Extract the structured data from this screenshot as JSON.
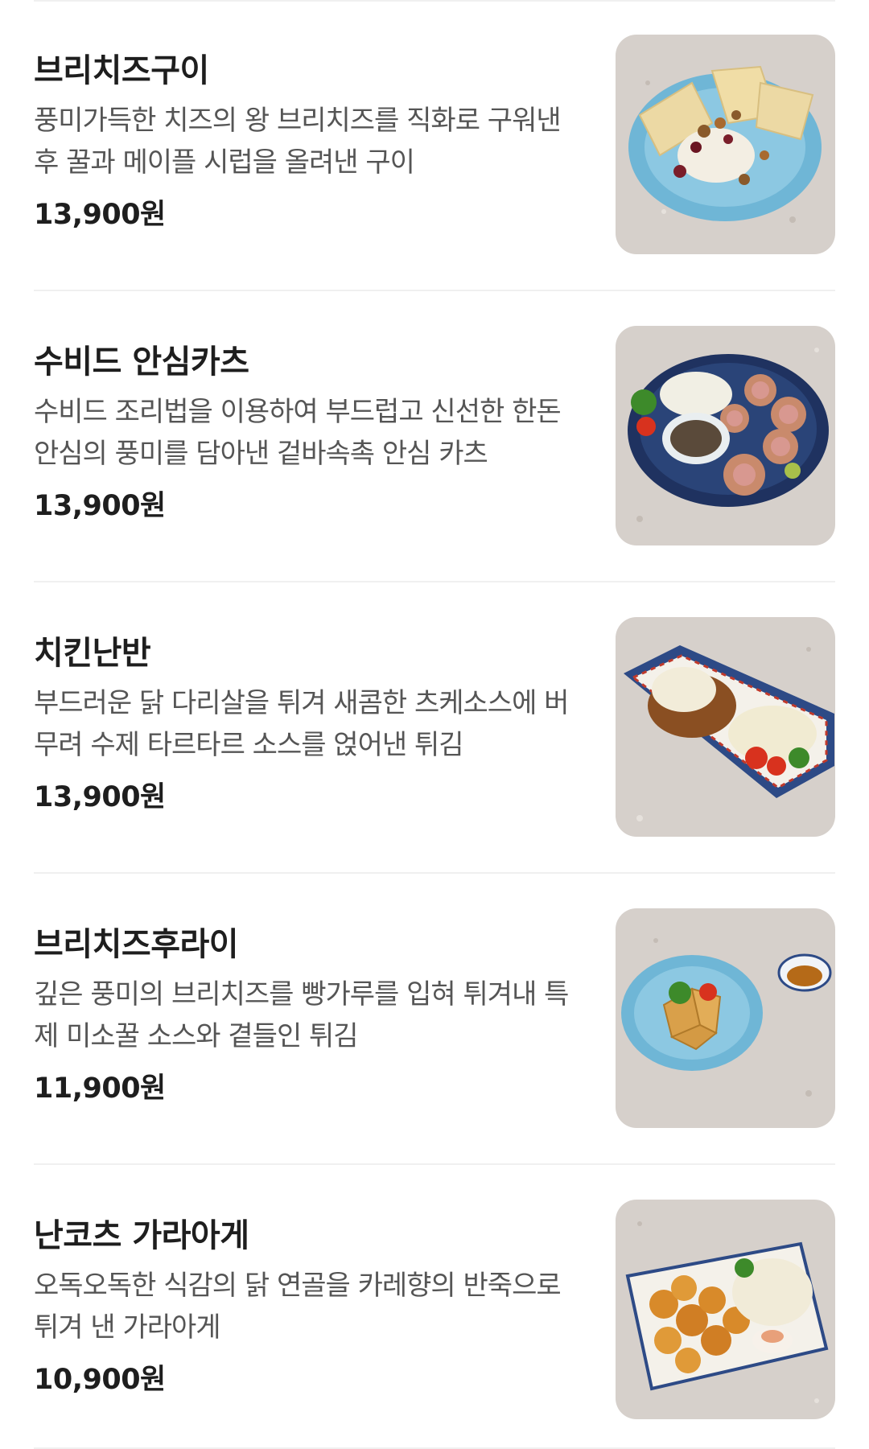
{
  "menu": {
    "items": [
      {
        "name": "브리치즈구이",
        "description": "풍미가득한 치즈의 왕 브리치즈를 직화로 구워낸 후 꿀과 메이플 시럽을 올려낸 구이",
        "price": "13,900원",
        "photo_icon": "brie-cheese-dish"
      },
      {
        "name": "수비드 안심카츠",
        "description": "수비드 조리법을 이용하여 부드럽고 신선한 한돈 안심의 풍미를 담아낸 겉바속촉 안심 카츠",
        "price": "13,900원",
        "photo_icon": "pork-cutlet-dish"
      },
      {
        "name": "치킨난반",
        "description": "부드러운 닭 다리살을 튀겨 새콤한 츠케소스에 버무려 수제 타르타르 소스를 얹어낸 튀김",
        "price": "13,900원",
        "photo_icon": "chicken-nanban-dish"
      },
      {
        "name": "브리치즈후라이",
        "description": "깊은 풍미의 브리치즈를 빵가루를 입혀 튀겨내 특제 미소꿀 소스와 곁들인 튀김",
        "price": "11,900원",
        "photo_icon": "fried-brie-dish"
      },
      {
        "name": "난코츠 가라아게",
        "description": "오독오독한 식감의 닭 연골을 카레향의 반죽으로 튀겨 낸 가라아게",
        "price": "10,900원",
        "photo_icon": "karaage-dish"
      }
    ]
  },
  "colors": {
    "background": "#ffffff",
    "title": "#1e1e1e",
    "description": "#555555",
    "divider": "#f0f0f0",
    "photo_background": "#d9d3ce"
  }
}
